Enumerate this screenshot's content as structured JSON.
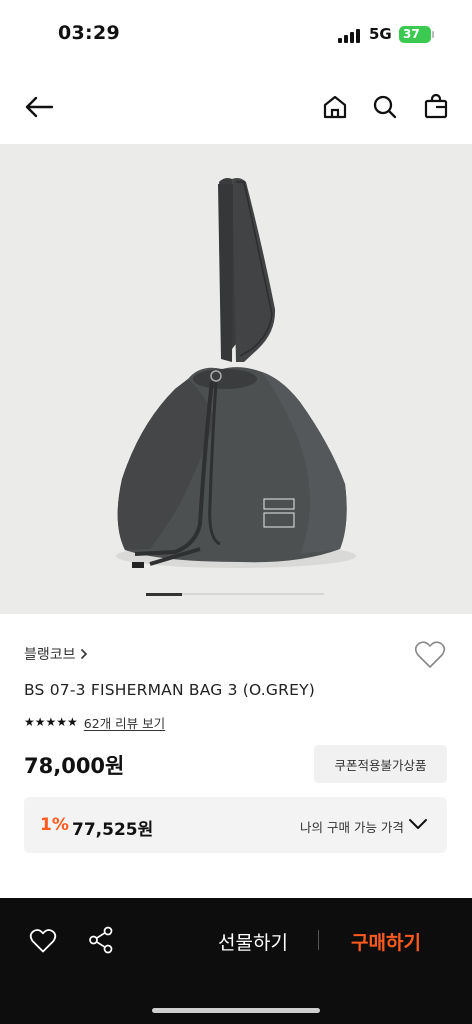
{
  "status_bar": {
    "time": "03:29",
    "network": "5G",
    "battery": "37"
  },
  "nav": {
    "back_icon": "arrow-left-icon",
    "home_icon": "home-icon",
    "search_icon": "search-icon",
    "bag_icon": "shopping-bag-icon"
  },
  "gallery": {
    "image_subject": "bag-photo",
    "current_page": 1,
    "total_pages": 5
  },
  "product": {
    "brand": "블랭코브",
    "name": "BS 07-3 FISHERMAN BAG 3 (O.GREY)",
    "stars": "★★★★★",
    "rating": 5,
    "review_link": "62개 리뷰 보기",
    "price": "78,000원",
    "coupon_badge": "쿠폰적용불가상품"
  },
  "my_price": {
    "discount_rate": "1%",
    "discount_price": "77,525원",
    "label": "나의 구매 가능 가격"
  },
  "bottom_bar": {
    "gift_label": "선물하기",
    "buy_label": "구매하기"
  },
  "colors": {
    "accent": "#ff5a1f",
    "bottom_bar": "#0d0d0d",
    "hero_bg": "#ebebea"
  }
}
